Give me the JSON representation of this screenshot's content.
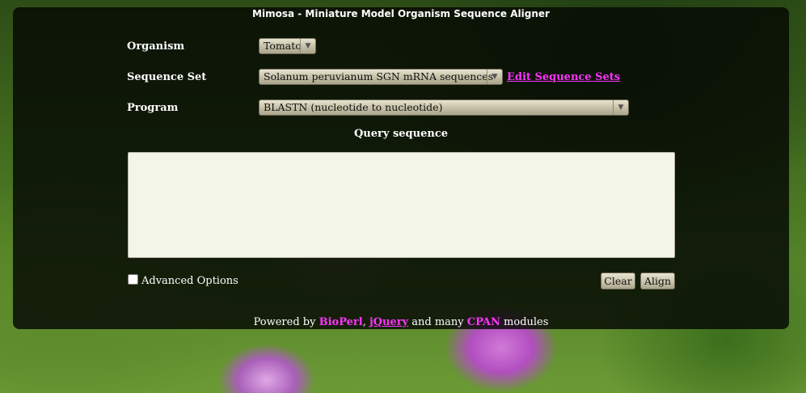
{
  "app": {
    "title": "Mimosa - Miniature Model Organism Sequence Aligner"
  },
  "form": {
    "organism_label": "Organism",
    "organism_value": "Tomato",
    "sequence_set_label": "Sequence Set",
    "sequence_set_value": "Solanum peruvianum SGN mRNA sequences",
    "edit_sets_link": "Edit Sequence Sets",
    "program_label": "Program",
    "program_value": "BLASTN (nucleotide to nucleotide)",
    "query_heading": "Query sequence",
    "query_value": "",
    "advanced_label": "Advanced Options",
    "advanced_checked": false
  },
  "buttons": {
    "clear": "Clear",
    "align": "Align"
  },
  "footer": {
    "prefix": "Powered by ",
    "link1": "BioPerl",
    "sep1": ", ",
    "link2": "jQuery",
    "middle": " and many ",
    "link3": "CPAN",
    "suffix": " modules"
  },
  "colors": {
    "link": "#ff33ff",
    "panel": "#060a04"
  }
}
